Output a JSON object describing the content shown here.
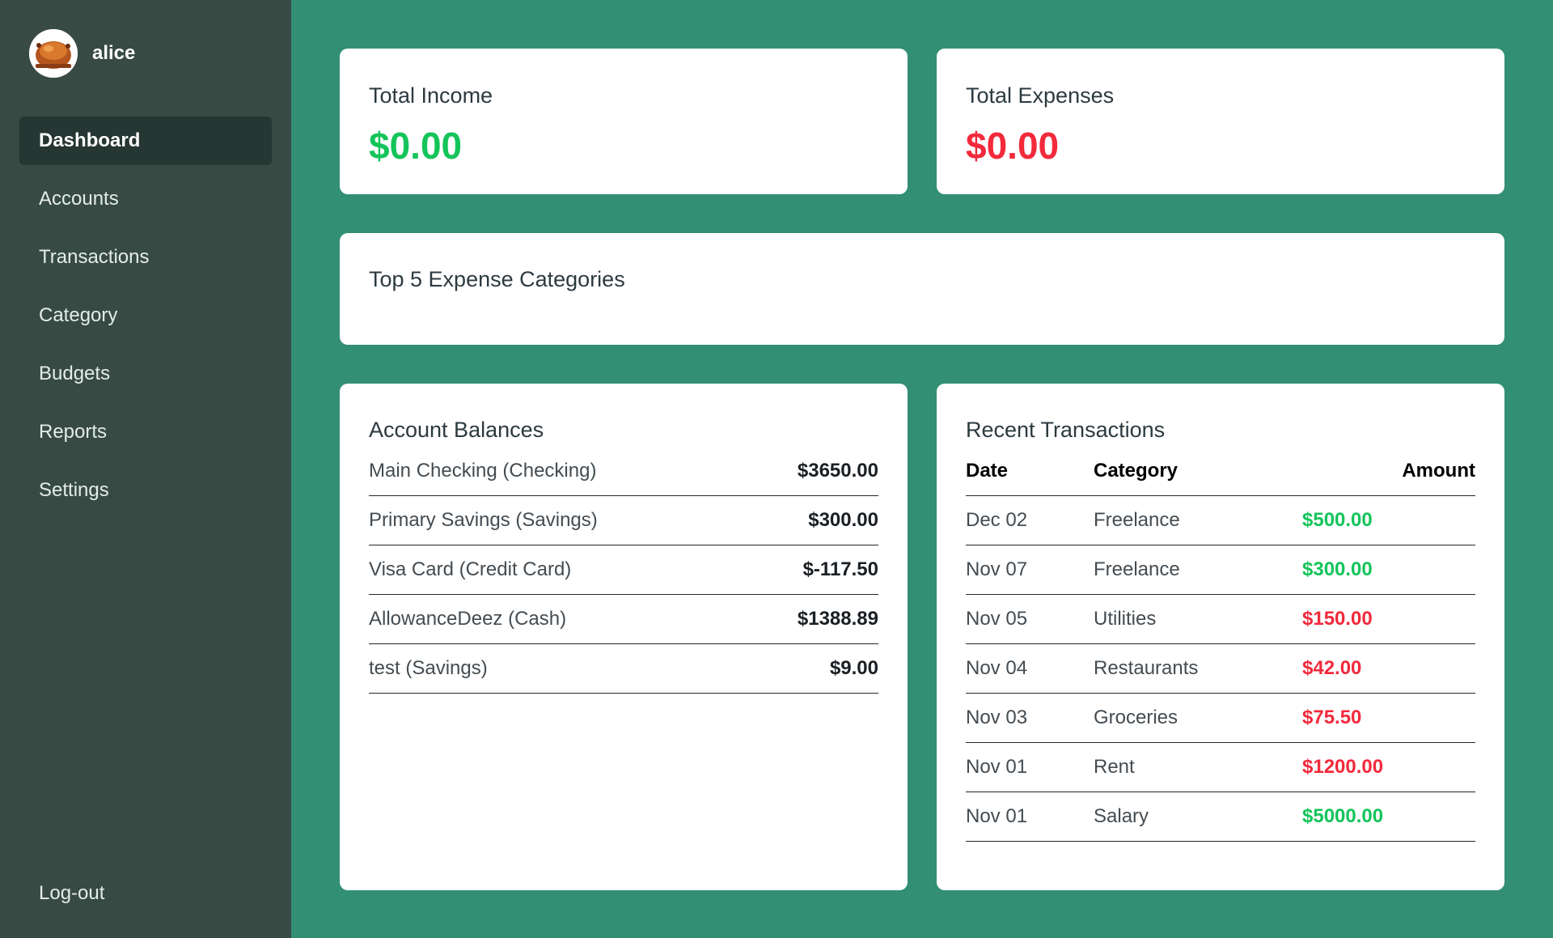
{
  "user": {
    "name": "alice"
  },
  "nav": {
    "items": [
      {
        "label": "Dashboard",
        "active": true
      },
      {
        "label": "Accounts"
      },
      {
        "label": "Transactions"
      },
      {
        "label": "Category"
      },
      {
        "label": "Budgets"
      },
      {
        "label": "Reports"
      },
      {
        "label": "Settings"
      }
    ],
    "logout": "Log-out"
  },
  "summary": {
    "income": {
      "label": "Total Income",
      "value": "$0.00"
    },
    "expenses": {
      "label": "Total Expenses",
      "value": "$0.00"
    }
  },
  "top_categories": {
    "title": "Top 5 Expense Categories"
  },
  "balances": {
    "title": "Account Balances",
    "rows": [
      {
        "name": "Main Checking (Checking)",
        "value": "$3650.00"
      },
      {
        "name": "Primary Savings (Savings)",
        "value": "$300.00"
      },
      {
        "name": "Visa Card (Credit Card)",
        "value": "$-117.50"
      },
      {
        "name": "AllowanceDeez (Cash)",
        "value": "$1388.89"
      },
      {
        "name": "test (Savings)",
        "value": "$9.00"
      }
    ]
  },
  "transactions": {
    "title": "Recent Transactions",
    "headers": {
      "date": "Date",
      "category": "Category",
      "amount": "Amount"
    },
    "rows": [
      {
        "date": "Dec 02",
        "category": "Freelance",
        "amount": "$500.00",
        "type": "income"
      },
      {
        "date": "Nov 07",
        "category": "Freelance",
        "amount": "$300.00",
        "type": "income"
      },
      {
        "date": "Nov 05",
        "category": "Utilities",
        "amount": "$150.00",
        "type": "expense"
      },
      {
        "date": "Nov 04",
        "category": "Restaurants",
        "amount": "$42.00",
        "type": "expense"
      },
      {
        "date": "Nov 03",
        "category": "Groceries",
        "amount": "$75.50",
        "type": "expense"
      },
      {
        "date": "Nov 01",
        "category": "Rent",
        "amount": "$1200.00",
        "type": "expense"
      },
      {
        "date": "Nov 01",
        "category": "Salary",
        "amount": "$5000.00",
        "type": "income"
      }
    ]
  },
  "colors": {
    "background": "#338f74",
    "sidebar": "#384a44",
    "income": "#14c45a",
    "expense": "#f22a3c"
  }
}
